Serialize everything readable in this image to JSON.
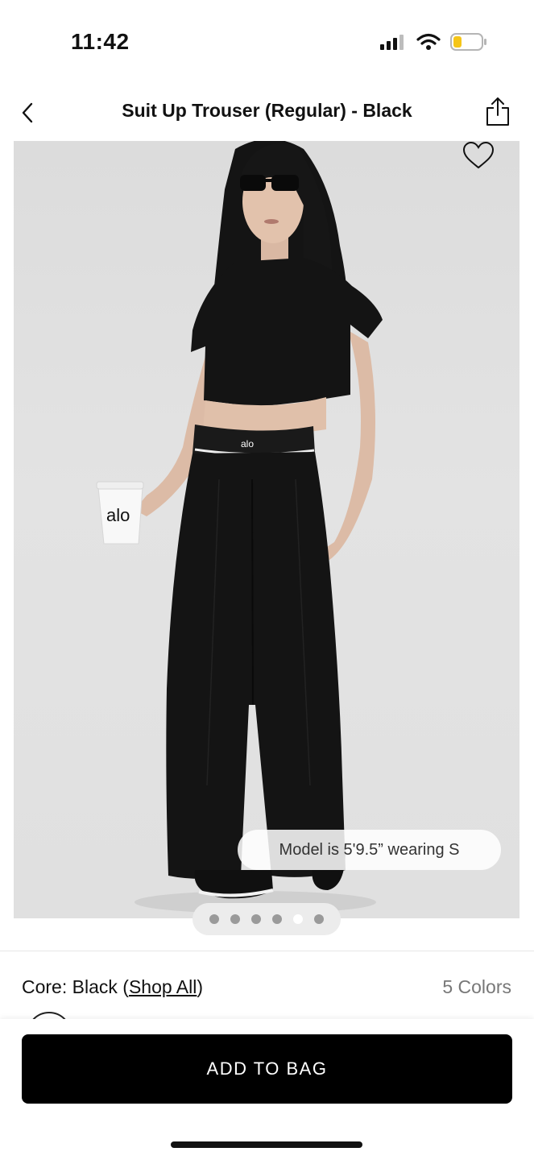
{
  "status_bar": {
    "time": "11:42"
  },
  "nav": {
    "title": "Suit Up Trouser (Regular) - Black",
    "back_icon": "chevron-left-icon",
    "share_icon": "share-icon"
  },
  "product_image": {
    "model_info": "Model is 5'9.5” wearing S",
    "wishlist_icon": "heart-outline-icon",
    "cup_logo": "alo",
    "waistband_logo": "alo",
    "carousel": {
      "count": 6,
      "active_index": 4
    }
  },
  "color_selector": {
    "label_prefix": "Core: Black (",
    "shop_all": "Shop All",
    "label_suffix": ")",
    "colors_count": "5 Colors"
  },
  "actions": {
    "add_to_bag": "ADD TO BAG"
  },
  "colors": {
    "accent": "#000000",
    "battery_level": "#f5c518"
  }
}
